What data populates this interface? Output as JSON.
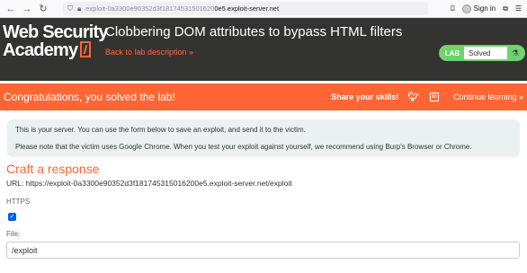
{
  "browser": {
    "url_prefix": "exploit-0a3300e90352d3f18174531501620",
    "url_host": "0e5.exploit-server.net",
    "signin_label": "Sign in"
  },
  "header": {
    "logo_line1": "Web Security",
    "logo_line2": "Academy",
    "lab_title": "Clobbering DOM attributes to bypass HTML filters",
    "back_link": "Back to lab description »",
    "badge_lab": "LAB",
    "badge_status": "Solved"
  },
  "banner": {
    "congrats": "Congratulations, you solved the lab!",
    "share": "Share your skills!",
    "continue": "Continue learning »"
  },
  "notice": {
    "line1": "This is your server. You can use the form below to save an exploit, and send it to the victim.",
    "line2": "Please note that the victim uses Google Chrome. When you test your exploit against yourself, we recommend using Burp's Browser or Chrome."
  },
  "form": {
    "title": "Craft a response",
    "url_line": "URL: https://exploit-0a3300e90352d3f181745315016200e5.exploit-server.net/exploit",
    "https_label": "HTTPS",
    "https_checked": true,
    "file_label": "File:",
    "file_value": "/exploit"
  },
  "colors": {
    "brand_orange": "#ff6633",
    "header_dark": "#333332",
    "solved_green": "#70d16d"
  }
}
